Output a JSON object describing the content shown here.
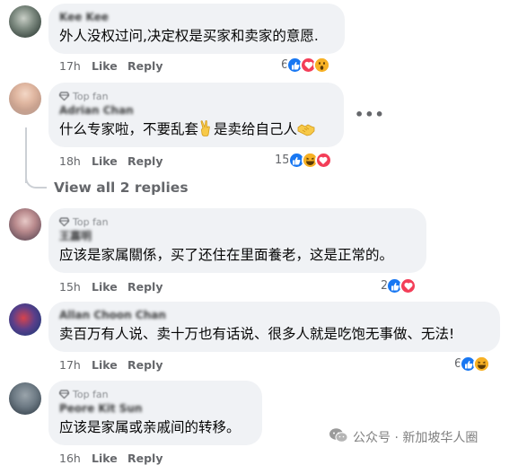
{
  "comments": [
    {
      "name": "Kee Kee",
      "top_fan": false,
      "text": "外人没权过问,决定权是买家和卖家的意愿.",
      "time": "17h",
      "like_label": "Like",
      "reply_label": "Reply",
      "reaction_count": "6",
      "reactions": [
        "like",
        "love",
        "wow"
      ]
    },
    {
      "name": "Adrian Chan",
      "top_fan": true,
      "top_fan_label": "Top fan",
      "text_before": "什么专家啦，不要乱套",
      "text_middle": "是卖给自己人",
      "time": "18h",
      "like_label": "Like",
      "reply_label": "Reply",
      "reaction_count": "15",
      "reactions": [
        "like",
        "haha",
        "love"
      ]
    },
    {
      "name": "王嘉明",
      "top_fan": true,
      "top_fan_label": "Top fan",
      "text": "应该是家属關係，买了还住在里面養老，这是正常的。",
      "time": "15h",
      "like_label": "Like",
      "reply_label": "Reply",
      "reaction_count": "2",
      "reactions": [
        "like",
        "love"
      ]
    },
    {
      "name": "Allan Choon Chan",
      "top_fan": false,
      "text": "卖百万有人说、卖十万也有话说、很多人就是吃饱无事做、无法!",
      "time": "17h",
      "like_label": "Like",
      "reply_label": "Reply",
      "reaction_count": "6",
      "reactions": [
        "like",
        "haha"
      ]
    },
    {
      "name": "Peore Kit Sun",
      "top_fan": true,
      "top_fan_label": "Top fan",
      "text": "应该是家属或亲戚间的转移。",
      "time": "16h",
      "like_label": "Like",
      "reply_label": "Reply"
    }
  ],
  "view_replies_label": "View all 2 replies",
  "more_label": "•••",
  "watermark": "公众号 · 新加坡华人圈",
  "colors": {
    "like": "#1877f2",
    "love": "#f33e58",
    "haha": "#f7b125",
    "bubble": "#f0f2f5",
    "meta": "#65676b"
  },
  "icons": [
    "diamond-icon",
    "like-reaction-icon",
    "love-reaction-icon",
    "wow-reaction-icon",
    "haha-reaction-icon",
    "victory-hand-icon",
    "handshake-icon",
    "wechat-icon",
    "more-options-icon"
  ]
}
